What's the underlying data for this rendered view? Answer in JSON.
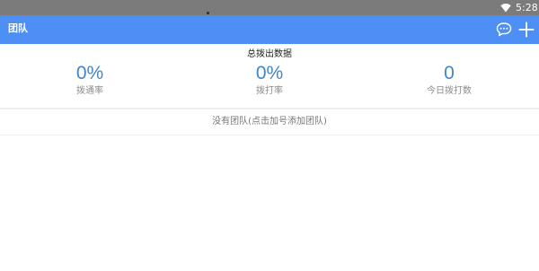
{
  "status_bar": {
    "time": "5:28",
    "wifi_icon": "wifi-icon"
  },
  "app_bar": {
    "title": "团队",
    "actions": [
      {
        "icon": "chat-bubble-icon"
      },
      {
        "icon": "plus-icon"
      }
    ],
    "color": "#4d8ff5"
  },
  "summary": {
    "title": "总拨出数据",
    "stats": [
      {
        "value": "0%",
        "label": "拨通率"
      },
      {
        "value": "0%",
        "label": "拨打率"
      },
      {
        "value": "0",
        "label": "今日拨打数"
      }
    ],
    "value_color": "#3f86c8"
  },
  "team_list": {
    "empty_text": "没有团队(点击加号添加团队)"
  }
}
